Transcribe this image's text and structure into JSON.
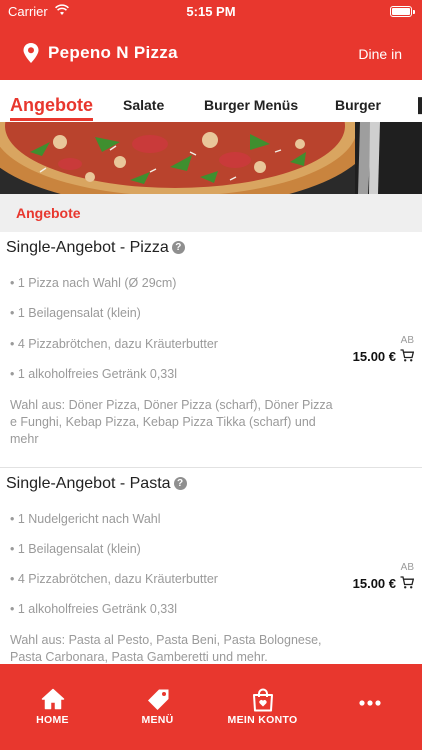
{
  "status_bar": {
    "carrier": "Carrier",
    "time": "5:15 PM"
  },
  "header": {
    "title": "Pepeno N Pizza",
    "mode": "Dine in"
  },
  "tabs": [
    "Angebote",
    "Salate",
    "Burger Menüs",
    "Burger"
  ],
  "active_tab": "Angebote",
  "section_title": "Angebote",
  "items": [
    {
      "name": "Single-Angebot - Pizza",
      "bullets": [
        "• 1 Pizza nach Wahl (Ø 29cm)",
        "• 1 Beilagensalat (klein)",
        "• 4 Pizzabrötchen, dazu Kräuterbutter",
        "• 1 alkoholfreies Getränk 0,33l"
      ],
      "description": "Wahl aus: Döner Pizza, Döner Pizza (scharf), Döner Pizza e Funghi, Kebap Pizza, Kebap Pizza Tikka (scharf) und mehr",
      "price_prefix": "AB",
      "price": "15.00 €"
    },
    {
      "name": "Single-Angebot - Pasta",
      "bullets": [
        "• 1 Nudelgericht nach Wahl",
        "• 1 Beilagensalat (klein)",
        "• 4 Pizzabrötchen, dazu Kräuterbutter",
        "• 1 alkoholfreies Getränk 0,33l"
      ],
      "description": "Wahl aus: Pasta al Pesto, Pasta Beni, Pasta Bolognese, Pasta Carbonara, Pasta Gamberetti und mehr.",
      "price_prefix": "AB",
      "price": "15.00 €"
    }
  ],
  "bottom_nav": [
    {
      "label": "HOME",
      "icon": "home-icon"
    },
    {
      "label": "MENÜ",
      "icon": "tag-icon"
    },
    {
      "label": "MEIN KONTO",
      "icon": "shopping-bag-icon"
    },
    {
      "label": "",
      "icon": "more-icon"
    }
  ],
  "colors": {
    "brand": "#e8372e",
    "muted_text": "#9a9a9a",
    "section_bg": "#efefef"
  }
}
